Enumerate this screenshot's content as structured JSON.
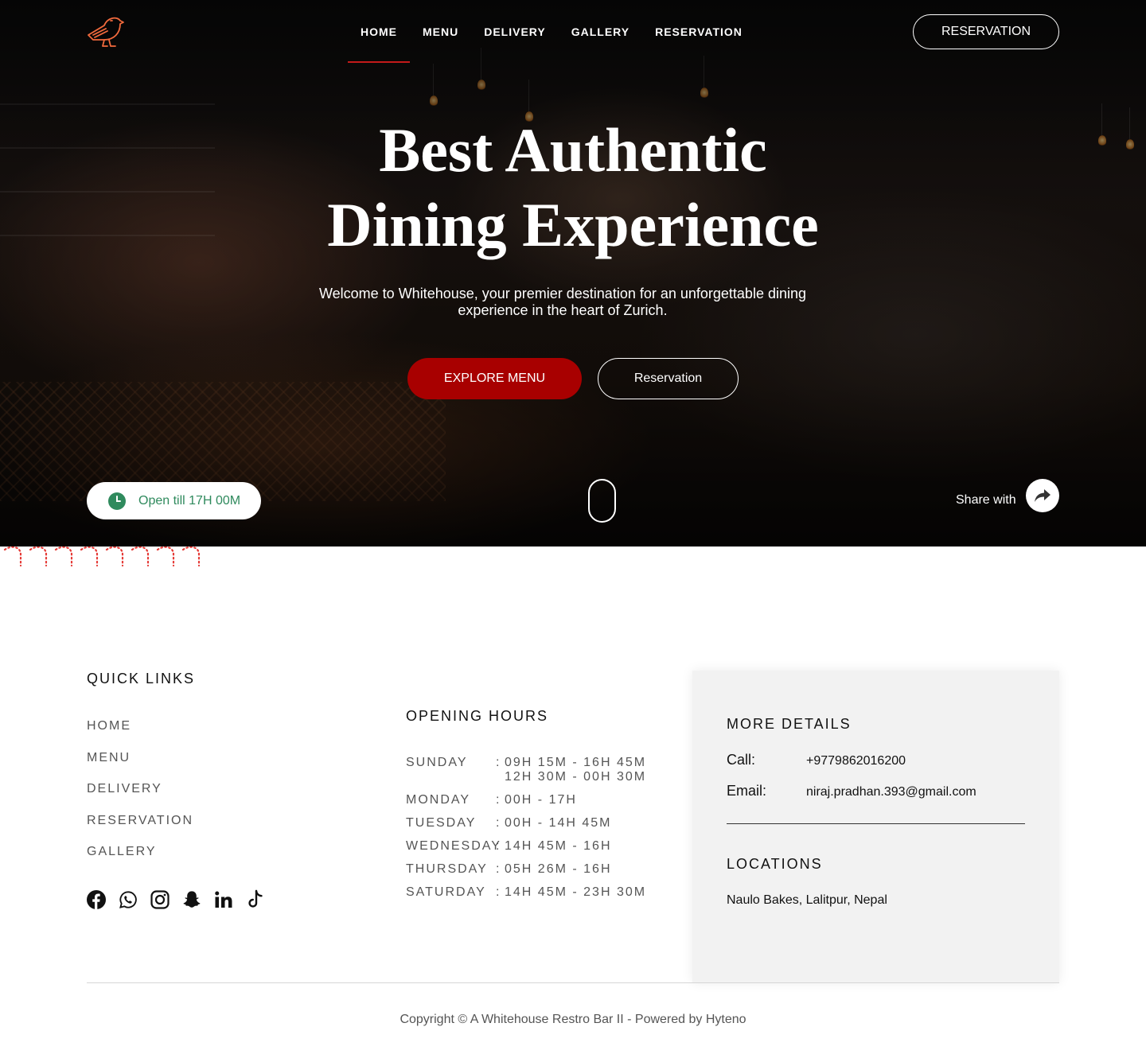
{
  "nav": {
    "items": [
      "HOME",
      "MENU",
      "DELIVERY",
      "GALLERY",
      "RESERVATION"
    ],
    "active": "HOME",
    "reservation_button": "RESERVATION"
  },
  "hero": {
    "title_line1": "Best Authentic",
    "title_line2": "Dining Experience",
    "subtitle": "Welcome to Whitehouse, your premier destination for an unforgettable dining experience in the heart of Zurich.",
    "explore_button": "EXPLORE MENU",
    "reservation_button": "Reservation",
    "open_status": "Open till 17H 00M",
    "share_label": "Share with"
  },
  "colors": {
    "accent_red": "#a80000",
    "nav_underline": "#c41a1a",
    "open_green": "#2f8a5d",
    "logo_orange": "#f26a3d"
  },
  "footer": {
    "quick_links": {
      "title": "QUICK LINKS",
      "items": [
        "HOME",
        "MENU",
        "DELIVERY",
        "RESERVATION",
        "GALLERY"
      ]
    },
    "socials": [
      "facebook-icon",
      "whatsapp-icon",
      "instagram-icon",
      "snapchat-icon",
      "linkedin-icon",
      "tiktok-icon"
    ],
    "opening_hours": {
      "title": "OPENING HOURS",
      "rows": [
        {
          "day": "SUNDAY",
          "colon": ":",
          "times": [
            "09H 15M - 16H 45M",
            "12H 30M - 00H 30M"
          ]
        },
        {
          "day": "MONDAY",
          "colon": ":",
          "times": [
            "00H - 17H"
          ]
        },
        {
          "day": "TUESDAY",
          "colon": ":",
          "times": [
            "00H - 14H 45M"
          ]
        },
        {
          "day": "WEDNESDAY",
          "colon": ":",
          "times": [
            "14H 45M - 16H"
          ]
        },
        {
          "day": "THURSDAY",
          "colon": ":",
          "times": [
            "05H 26M - 16H"
          ]
        },
        {
          "day": "SATURDAY",
          "colon": ":",
          "times": [
            "14H 45M - 23H 30M"
          ]
        }
      ]
    },
    "more_details": {
      "title": "MORE DETAILS",
      "call_label": "Call:",
      "call_value": "+9779862016200",
      "email_label": "Email:",
      "email_value": "niraj.pradhan.393@gmail.com"
    },
    "locations": {
      "title": "LOCATIONS",
      "address": "Naulo Bakes, Lalitpur, Nepal"
    },
    "copyright": "Copyright © A Whitehouse Restro Bar II - Powered by Hyteno"
  }
}
